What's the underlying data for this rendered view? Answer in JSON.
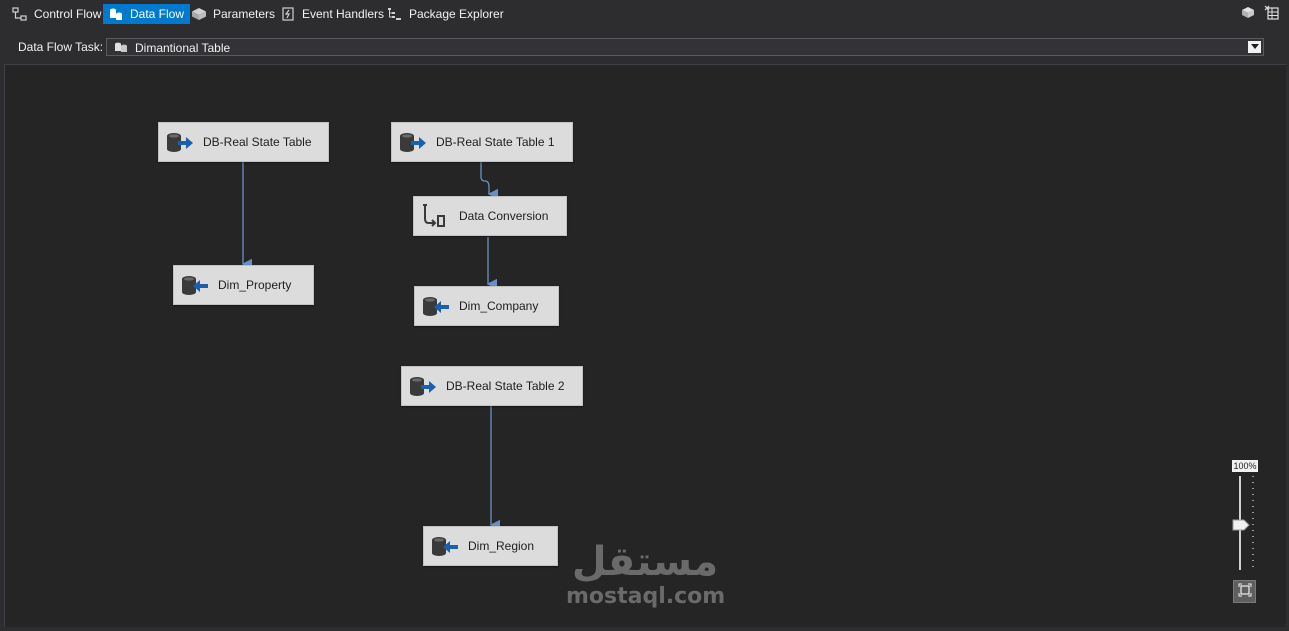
{
  "tabs": [
    {
      "label": "Control Flow",
      "icon": "control-flow-icon",
      "active": false
    },
    {
      "label": "Data Flow",
      "icon": "data-flow-icon",
      "active": true
    },
    {
      "label": "Parameters",
      "icon": "parameters-icon",
      "active": false
    },
    {
      "label": "Event Handlers",
      "icon": "event-handlers-icon",
      "active": false
    },
    {
      "label": "Package Explorer",
      "icon": "package-explorer-icon",
      "active": false
    }
  ],
  "top_right_icons": [
    "package-icon",
    "variables-grid-icon"
  ],
  "task_bar": {
    "label": "Data Flow Task:",
    "selected": "Dimantional Table"
  },
  "components": [
    {
      "label": "DB-Real State Table",
      "type": "source"
    },
    {
      "label": "Dim_Property",
      "type": "destination"
    },
    {
      "label": "DB-Real State Table 1",
      "type": "source"
    },
    {
      "label": "Data Conversion",
      "type": "transform"
    },
    {
      "label": "Dim_Company",
      "type": "destination"
    },
    {
      "label": "DB-Real State Table 2",
      "type": "source"
    },
    {
      "label": "Dim_Region",
      "type": "destination"
    }
  ],
  "zoom": {
    "label": "100%",
    "level_percent": 100
  },
  "watermark": {
    "arabic": "مستقل",
    "latin": "mostaql.com"
  },
  "colors": {
    "active_tab": "#007acc",
    "canvas": "#252526",
    "node_fill": "#dcdcdc",
    "connector": "#6a8fc6",
    "arrow_blue": "#1c5faa"
  }
}
